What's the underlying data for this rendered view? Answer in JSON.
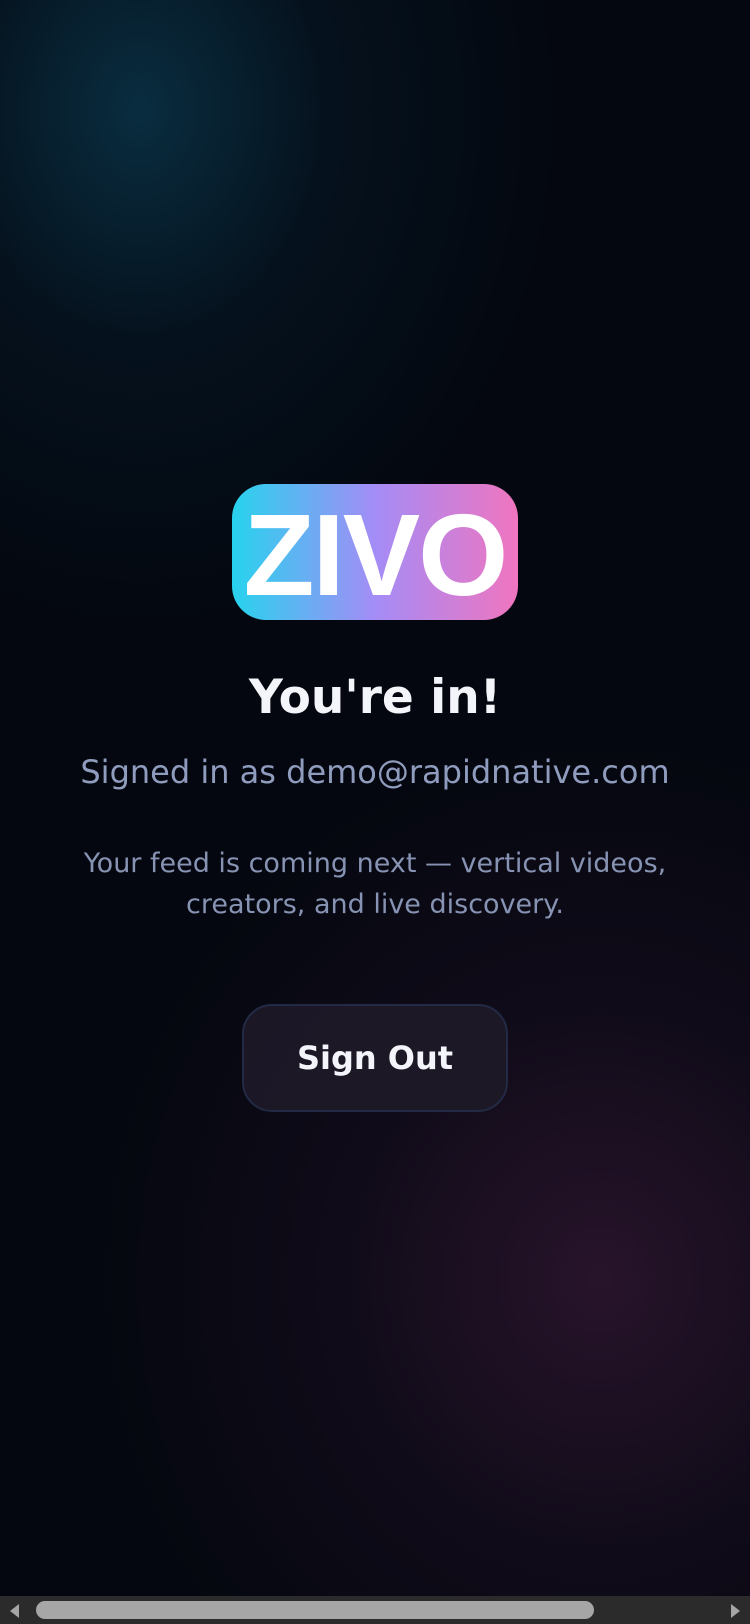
{
  "logo": {
    "text": "ZIVO"
  },
  "heading": "You're in!",
  "signed_in_text": "Signed in as demo@rapidnative.com",
  "description": "Your feed is coming next — vertical videos, creators, and live discovery.",
  "sign_out_label": "Sign Out",
  "colors": {
    "background": "#04070f",
    "logo_gradient": [
      "#27d3ee",
      "#a48cf6",
      "#f075bf"
    ],
    "heading": "#f4f5fa",
    "muted_text": "#8f9cbd",
    "button_bg": "#1e1a28",
    "button_border": "#222a45"
  },
  "icons": {
    "scroll_left": "chevron-left-icon",
    "scroll_right": "chevron-right-icon"
  }
}
